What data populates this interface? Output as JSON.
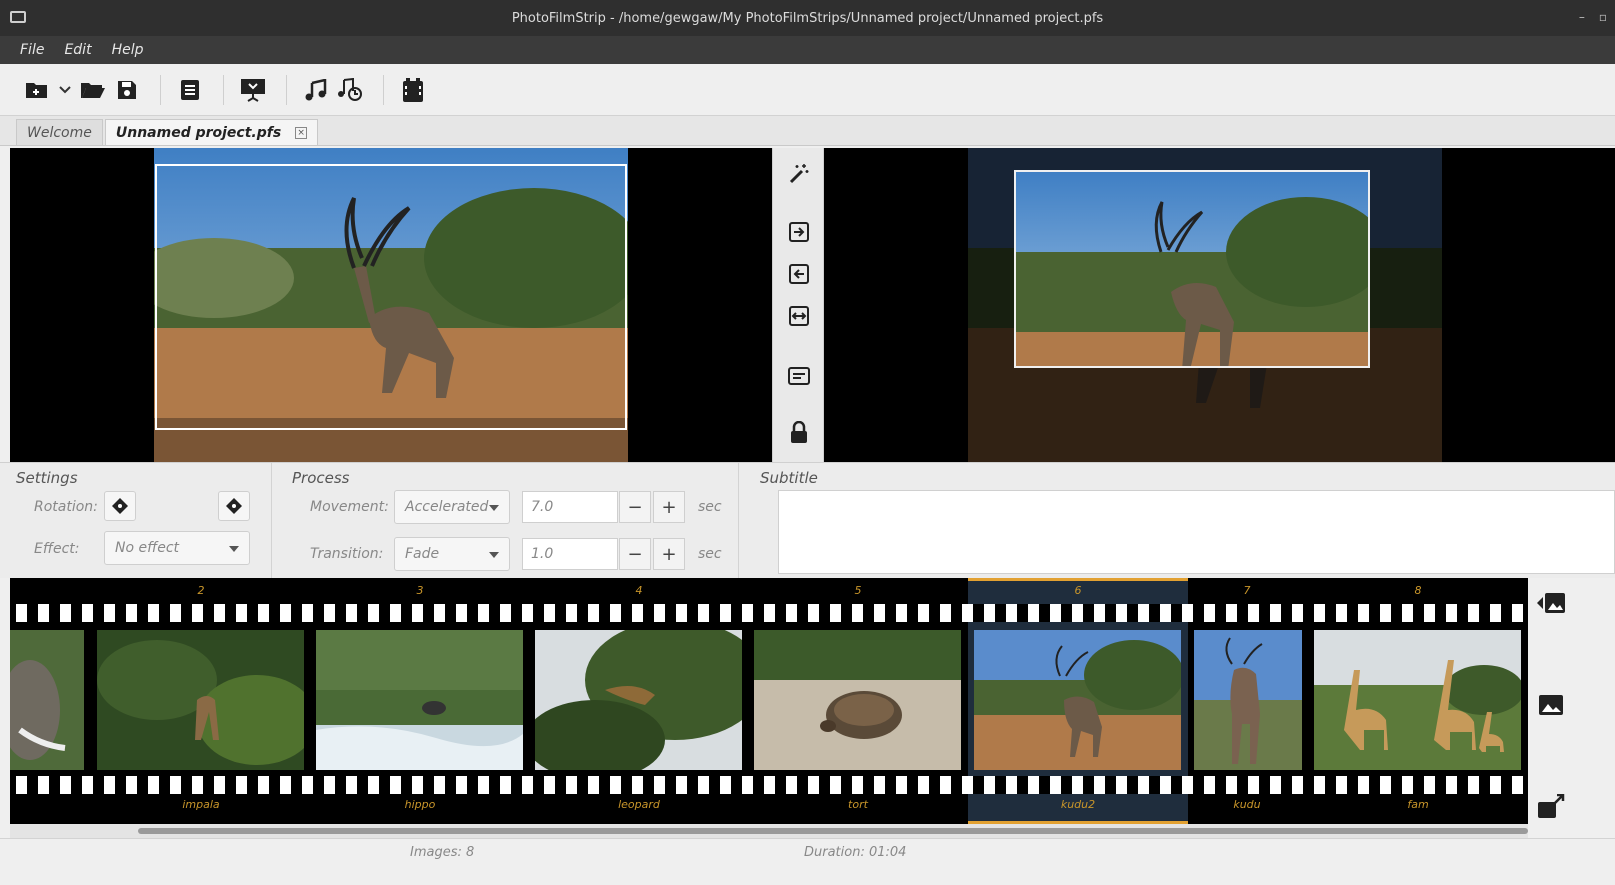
{
  "window": {
    "title": "PhotoFilmStrip - /home/gewgaw/My PhotoFilmStrips/Unnamed project/Unnamed project.pfs"
  },
  "menu": [
    "File",
    "Edit",
    "Help"
  ],
  "tabs": [
    {
      "label": "Welcome"
    },
    {
      "label": "Unnamed project.pfs",
      "close": "×"
    }
  ],
  "settings": {
    "title": "Settings",
    "rotation_label": "Rotation:",
    "effect_label": "Effect:",
    "effect_value": "No effect"
  },
  "process": {
    "title": "Process",
    "movement_label": "Movement:",
    "movement_value": "Accelerated",
    "movement_duration": "7.0",
    "transition_label": "Transition:",
    "transition_value": "Fade",
    "transition_duration": "1.0",
    "unit": "sec",
    "minus": "−",
    "plus": "+"
  },
  "subtitle": {
    "title": "Subtitle",
    "value": ""
  },
  "filmstrip": {
    "frames": [
      {
        "num": "",
        "name": ""
      },
      {
        "num": "2",
        "name": "impala"
      },
      {
        "num": "3",
        "name": "hippo"
      },
      {
        "num": "4",
        "name": "leopard"
      },
      {
        "num": "5",
        "name": "tort"
      },
      {
        "num": "6",
        "name": "kudu2"
      },
      {
        "num": "7",
        "name": "kudu"
      },
      {
        "num": "8",
        "name": "fam"
      }
    ],
    "selected": "6"
  },
  "status": {
    "images": "Images: 8",
    "duration": "Duration: 01:04"
  }
}
